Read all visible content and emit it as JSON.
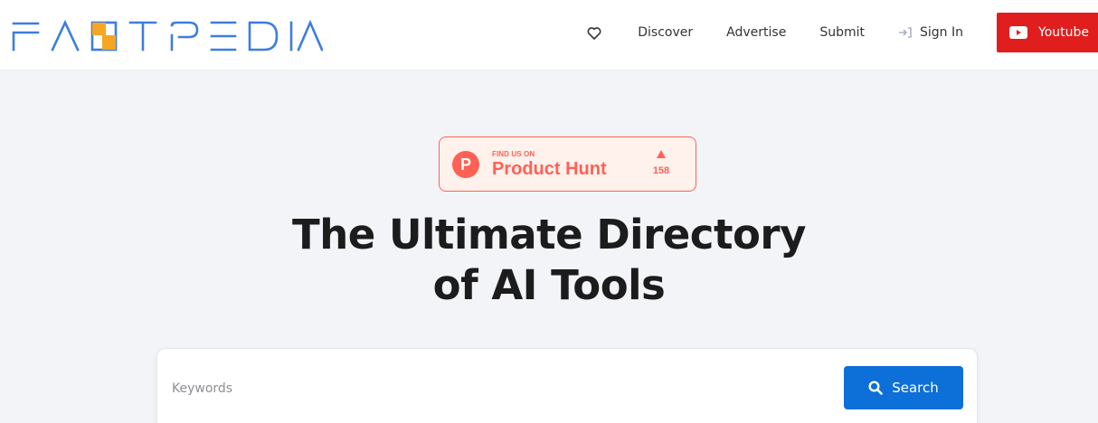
{
  "brand": {
    "name": "FASTPEDIA",
    "accent": "#f5a623"
  },
  "nav": {
    "favorites_icon": "heart-icon",
    "discover": "Discover",
    "advertise": "Advertise",
    "submit": "Submit",
    "sign_in": "Sign In",
    "sign_in_icon": "sign-in-icon",
    "youtube": "Youtube",
    "youtube_color": "#e01e1e"
  },
  "product_hunt": {
    "tagline": "FIND US ON",
    "name": "Product Hunt",
    "logo_letter": "P",
    "upvotes": "158",
    "color": "#ff6154"
  },
  "hero": {
    "line1": "The Ultimate Directory",
    "line2": "of AI Tools"
  },
  "search": {
    "placeholder": "Keywords",
    "value": "",
    "button_label": "Search",
    "button_color": "#0d6fd8"
  }
}
